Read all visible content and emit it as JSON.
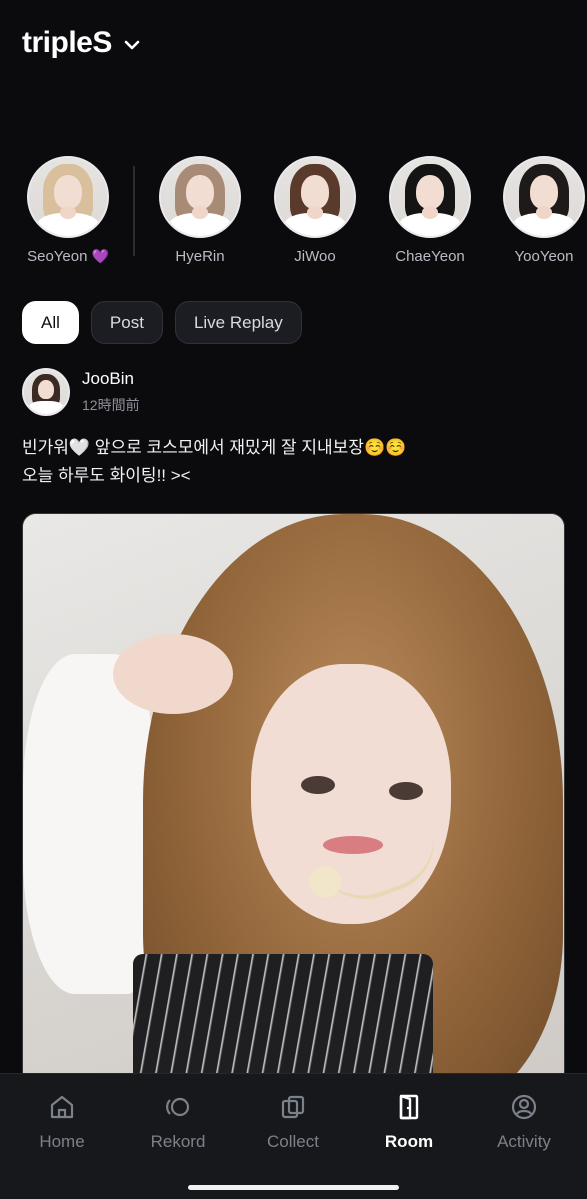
{
  "header": {
    "title": "tripleS"
  },
  "stories": [
    {
      "name": "SeoYeon",
      "badge": "💜",
      "hair": "#d9bf9b"
    },
    {
      "name": "HyeRin",
      "badge": "",
      "hair": "#a88b76"
    },
    {
      "name": "JiWoo",
      "badge": "",
      "hair": "#5a3a2a"
    },
    {
      "name": "ChaeYeon",
      "badge": "",
      "hair": "#141414"
    },
    {
      "name": "YooYeon",
      "badge": "",
      "hair": "#1e1a19"
    }
  ],
  "filters": [
    {
      "label": "All",
      "active": true
    },
    {
      "label": "Post",
      "active": false
    },
    {
      "label": "Live Replay",
      "active": false
    }
  ],
  "post": {
    "author": "JooBin",
    "time": "12時間前",
    "text_line1": "빈가워🤍 앞으로 코스모에서 재밌게 잘 지내보장☺️☺️",
    "text_line2": "오늘 하루도 화이팅!! ><",
    "author_hair": "#3b2a24"
  },
  "tabbar": [
    {
      "label": "Home",
      "icon": "home-icon",
      "active": false
    },
    {
      "label": "Rekord",
      "icon": "rekord-icon",
      "active": false
    },
    {
      "label": "Collect",
      "icon": "collect-icon",
      "active": false
    },
    {
      "label": "Room",
      "icon": "door-icon",
      "active": true
    },
    {
      "label": "Activity",
      "icon": "activity-icon",
      "active": false
    }
  ],
  "colors": {
    "background": "#0b0b0d",
    "tab_active": "#ffffff",
    "tab_inactive": "#7c8089",
    "accent_heart": "#b59af0"
  }
}
